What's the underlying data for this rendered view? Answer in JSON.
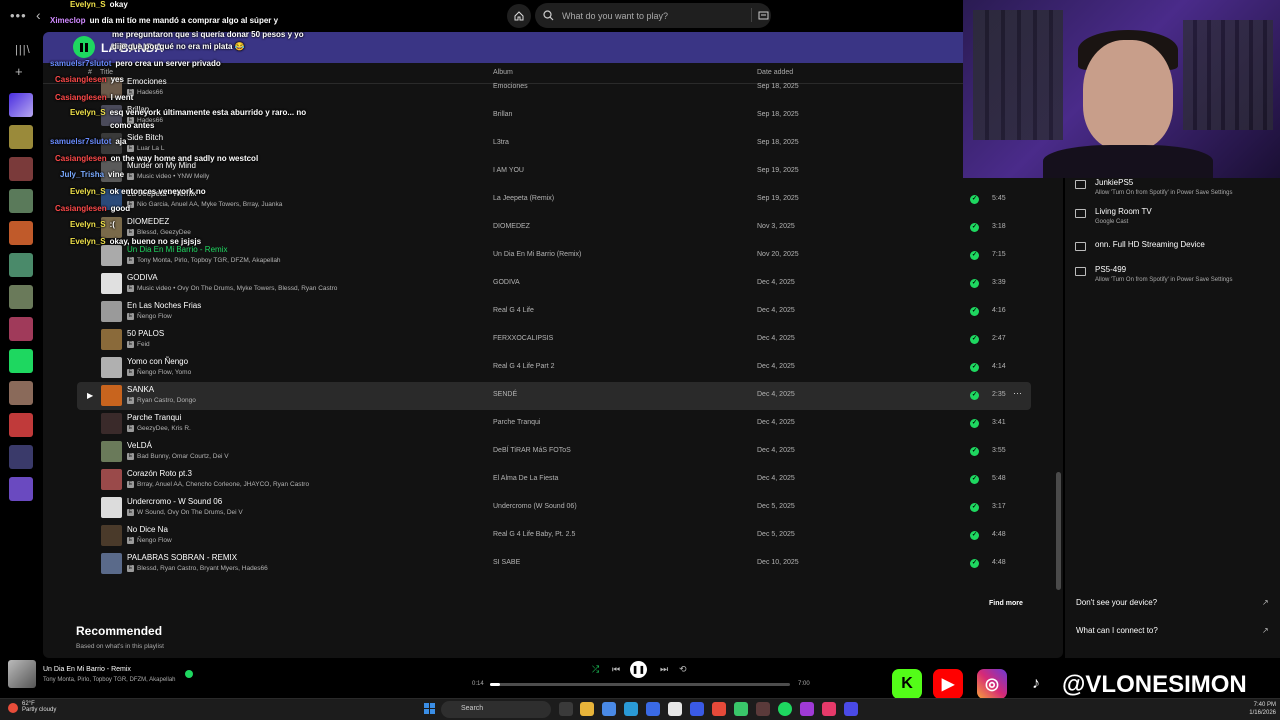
{
  "window": {
    "menu_dots": "•••",
    "back_glyph": "‹"
  },
  "search": {
    "placeholder": "What do you want to play?"
  },
  "playlist": {
    "title": "LA BANDA",
    "col_hash": "#",
    "col_title": "Title",
    "col_album": "Album",
    "col_date": "Date added"
  },
  "tracks": [
    {
      "title": "Emociones",
      "artists": "Hades66",
      "album": "Emociones",
      "date": "Sep 18, 2025",
      "duration": "",
      "color": "#6b5a4a"
    },
    {
      "title": "Brillan",
      "artists": "Hades66",
      "album": "Brillan",
      "date": "Sep 18, 2025",
      "duration": "",
      "color": "#4a4a5a"
    },
    {
      "title": "Side Bitch",
      "artists": "Luar La L",
      "album": "L3tra",
      "date": "Sep 18, 2025",
      "duration": "",
      "color": "#3a3a3a"
    },
    {
      "title": "Murder on My Mind",
      "artists": "Music video • YNW Melly",
      "album": "I AM YOU",
      "date": "Sep 19, 2025",
      "duration": "",
      "color": "#5a5a5a"
    },
    {
      "title": "La Jeepeta - Remix",
      "artists": "Nio Garcia, Anuel AA, Myke Towers, Brray, Juanka",
      "album": "La Jeepeta (Remix)",
      "date": "Sep 19, 2025",
      "duration": "5:45",
      "color": "#2a4a7a"
    },
    {
      "title": "DIOMEDEZ",
      "artists": "Blessd, GeezyDee",
      "album": "DIOMEDEZ",
      "date": "Nov 3, 2025",
      "duration": "3:18",
      "color": "#7a6a4a"
    },
    {
      "title": "Un Dia En Mi Barrio - Remix",
      "artists": "Tony Monta, Pirlo, Topboy TGR, DFZM, Akapellah",
      "album": "Un Dia En Mi Barrio (Remix)",
      "date": "Nov 20, 2025",
      "duration": "7:15",
      "color": "#aaaaaa",
      "playing": true
    },
    {
      "title": "GODIVA",
      "artists": "Music video • Ovy On The Drums, Myke Towers, Blessd, Ryan Castro",
      "album": "GODIVA",
      "date": "Dec 4, 2025",
      "duration": "3:39",
      "color": "#e0e0e0"
    },
    {
      "title": "En Las Noches Frias",
      "artists": "Ñengo Flow",
      "album": "Real G 4 Life",
      "date": "Dec 4, 2025",
      "duration": "4:16",
      "color": "#9a9a9a"
    },
    {
      "title": "50 PALOS",
      "artists": "Feid",
      "album": "FERXXOCALIPSIS",
      "date": "Dec 4, 2025",
      "duration": "2:47",
      "color": "#8a6a3a"
    },
    {
      "title": "Yomo con Ñengo",
      "artists": "Ñengo Flow, Yomo",
      "album": "Real G 4 Life Part 2",
      "date": "Dec 4, 2025",
      "duration": "4:14",
      "color": "#b0b0b0"
    },
    {
      "title": "SANKA",
      "artists": "Ryan Castro, Dongo",
      "album": "SENDÉ",
      "date": "Dec 4, 2025",
      "duration": "2:35",
      "color": "#c8641e",
      "hover": true
    },
    {
      "title": "Parche Tranqui",
      "artists": "GeezyDee, Kris R.",
      "album": "Parche Tranqui",
      "date": "Dec 4, 2025",
      "duration": "3:41",
      "color": "#3a2a2a"
    },
    {
      "title": "VeLDÁ",
      "artists": "Bad Bunny, Omar Courtz, Dei V",
      "album": "DeBÍ TiRAR MáS FOToS",
      "date": "Dec 4, 2025",
      "duration": "3:55",
      "color": "#6a7a5a"
    },
    {
      "title": "Corazón Roto pt.3",
      "artists": "Brray, Anuel AA, Chencho Corleone, JHAYCO, Ryan Castro",
      "album": "El Alma De La Fiesta",
      "date": "Dec 4, 2025",
      "duration": "5:48",
      "color": "#9a4a4a"
    },
    {
      "title": "Undercromo - W Sound 06",
      "artists": "W Sound, Ovy On The Drums, Dei V",
      "album": "Undercromo (W Sound 06)",
      "date": "Dec 5, 2025",
      "duration": "3:17",
      "color": "#dcdcdc"
    },
    {
      "title": "No Dice Na",
      "artists": "Ñengo Flow",
      "album": "Real G 4 Life Baby, Pt. 2.5",
      "date": "Dec 5, 2025",
      "duration": "4:48",
      "color": "#4a3a2a"
    },
    {
      "title": "PALABRAS SOBRAN - REMIX",
      "artists": "Blessd, Ryan Castro, Bryant Myers, Hades66",
      "album": "SI SABE",
      "date": "Dec 10, 2025",
      "duration": "4:48",
      "color": "#5a6a8a"
    }
  ],
  "find_more": "Find more",
  "recommended": {
    "title": "Recommended",
    "subtitle": "Based on what's in this playlist"
  },
  "chat": [
    {
      "user": "Evelyn_S",
      "msg": "okay",
      "color": "#f0e24a"
    },
    {
      "user": "Ximeclop",
      "msg": "un día mi tío me mandó a comprar algo al súper y",
      "color": "#d08aff"
    },
    {
      "user": "",
      "msg": "me preguntaron que si quería donar 50 pesos y yo",
      "color": "#fff"
    },
    {
      "user": "",
      "msg": "dije que por qué no era mi plata 😂",
      "color": "#fff"
    },
    {
      "user": "samuelsr7slutot",
      "msg": "pero crea un server privado",
      "color": "#6a8cff"
    },
    {
      "user": "Casianglesen",
      "msg": "yes",
      "color": "#ff4a4a"
    },
    {
      "user": "Casianglesen",
      "msg": "I went",
      "color": "#ff4a4a"
    },
    {
      "user": "Evelyn_S",
      "msg": "esq veneyork últimamente esta aburrido y raro... no",
      "color": "#f0e24a"
    },
    {
      "user": "",
      "msg": "como antes",
      "color": "#fff"
    },
    {
      "user": "samuelsr7slutot",
      "msg": "aja",
      "color": "#6a8cff"
    },
    {
      "user": "Casianglesen",
      "msg": "on the way home and sadly no westcol",
      "color": "#ff4a4a"
    },
    {
      "user": "July_Trisha",
      "msg": "vine",
      "color": "#7aaaff"
    },
    {
      "user": "Evelyn_S",
      "msg": "ok entonces veneyork no",
      "color": "#f0e24a"
    },
    {
      "user": "Casianglesen",
      "msg": "good",
      "color": "#ff4a4a"
    },
    {
      "user": "Evelyn_S",
      "msg": ":(",
      "color": "#f0e24a"
    },
    {
      "user": "Evelyn_S",
      "msg": "okay, bueno no se jsjsjs",
      "color": "#f0e24a"
    }
  ],
  "devices": [
    {
      "name": "JunkiePS5",
      "sub": "Allow 'Turn On from Spotify' in Power Save Settings",
      "icon": "gamepad-icon"
    },
    {
      "name": "Living Room TV",
      "sub": "Google Cast",
      "icon": "tv-icon"
    },
    {
      "name": "onn. Full HD Streaming Device",
      "sub": "",
      "icon": "tv-icon"
    },
    {
      "name": "PS5-499",
      "sub": "Allow 'Turn On from Spotify' in Power Save Settings",
      "icon": "gamepad-icon"
    }
  ],
  "device_links": {
    "dont_see": "Don't see your device?",
    "what_connect": "What can I connect to?"
  },
  "now_playing": {
    "title": "Un Dia En Mi Barrio - Remix",
    "artists": "Tony Monta, Pirlo, Topboy TGR, DFZM, Akapellah",
    "time_current": "0:14",
    "time_total": "7:00",
    "progress": 0.033
  },
  "socials": {
    "handle": "@VLONESIMON"
  },
  "taskbar": {
    "temp": "62°F",
    "weather": "Partly cloudy",
    "search_label": "Search",
    "time": "7:40 PM",
    "date": "1/16/2026"
  },
  "colors": {
    "accent": "#1ed760",
    "banner": "#3a3585",
    "panel": "#121212"
  }
}
